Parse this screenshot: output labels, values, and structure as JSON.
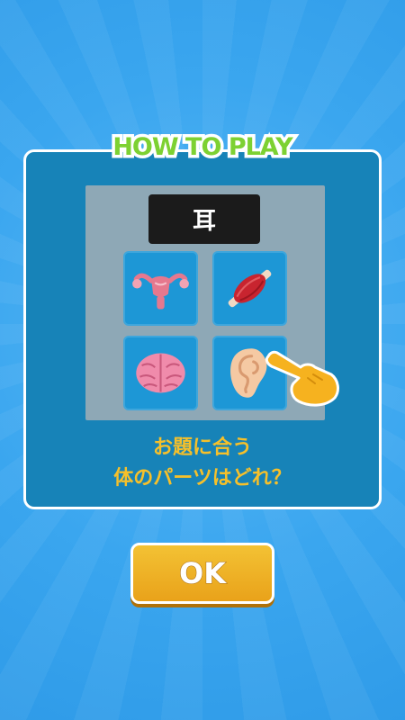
{
  "title": "HOW TO PLAY",
  "prompt_word": "耳",
  "choices": [
    {
      "icon": "uterus-icon"
    },
    {
      "icon": "muscle-icon"
    },
    {
      "icon": "brain-icon"
    },
    {
      "icon": "ear-icon"
    }
  ],
  "pointer_icon": "pointing-hand-icon",
  "question_line1": "お題に合う",
  "question_line2": "体のパーツはどれ？",
  "ok_label": "OK",
  "colors": {
    "background": "#3aa6ef",
    "panel": "#1783b8",
    "title": "#7dd132",
    "question_text": "#f6c02a",
    "ok_button": "#eeb028"
  }
}
